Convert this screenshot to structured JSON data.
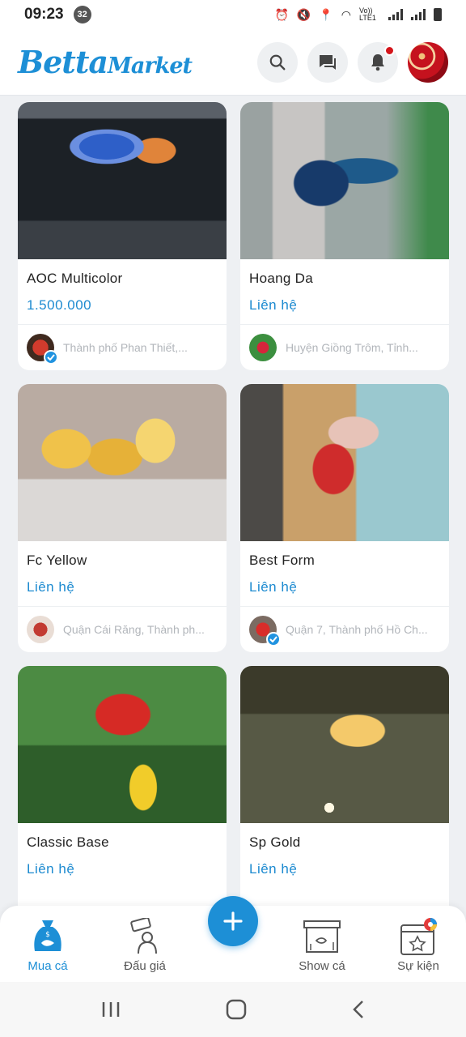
{
  "status_bar": {
    "time": "09:23",
    "notification_count": "32",
    "network_label": "Vo)) LTE1"
  },
  "header": {
    "logo_part1": "Betta",
    "logo_part2": "Market"
  },
  "products": [
    {
      "title": "AOC Multicolor",
      "price": "1.500.000",
      "location": "Thành phố Phan Thiết,...",
      "verified": true
    },
    {
      "title": "Hoang Da",
      "price": "Liên hệ",
      "location": "Huyện Giồng Trôm, Tỉnh...",
      "verified": false
    },
    {
      "title": "Fc Yellow",
      "price": "Liên hệ",
      "location": "Quận Cái Răng, Thành ph...",
      "verified": false
    },
    {
      "title": "Best Form",
      "price": "Liên hệ",
      "location": "Quận 7, Thành phố Hồ Ch...",
      "verified": true
    },
    {
      "title": "Classic Base",
      "price": "Liên hệ",
      "location": "",
      "verified": false
    },
    {
      "title": "Sp Gold",
      "price": "Liên hệ",
      "location": "",
      "verified": false
    }
  ],
  "bottom_nav": {
    "buy": "Mua cá",
    "auction": "Đấu giá",
    "show": "Show cá",
    "events": "Sự kiện"
  },
  "colors": {
    "accent": "#1d8fd6",
    "price": "#1c8ad0",
    "badge": "#d4151b"
  }
}
